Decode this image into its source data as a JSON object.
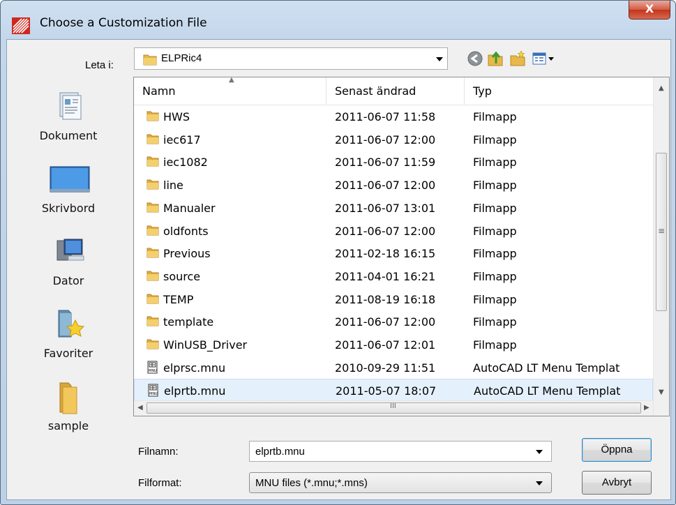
{
  "window": {
    "title": "Choose a Customization File",
    "close_glyph": "X",
    "icon": "autocad-logo-icon"
  },
  "lookin": {
    "label": "Leta i:",
    "value": "ELPRic4",
    "toolbar_icons": [
      "back-icon",
      "up-folder-icon",
      "new-folder-icon",
      "view-menu-icon"
    ]
  },
  "places": [
    {
      "label": "Dokument",
      "icon": "documents-icon"
    },
    {
      "label": "Skrivbord",
      "icon": "desktop-icon"
    },
    {
      "label": "Dator",
      "icon": "computer-icon"
    },
    {
      "label": "Favoriter",
      "icon": "favorites-icon"
    },
    {
      "label": "sample",
      "icon": "folder-icon"
    }
  ],
  "filelist": {
    "columns": [
      "Namn",
      "Senast ändrad",
      "Typ"
    ],
    "rows": [
      {
        "name": "HWS",
        "date": "2011-06-07 11:58",
        "type": "Filmapp",
        "icon": "folder-icon"
      },
      {
        "name": "iec617",
        "date": "2011-06-07 12:00",
        "type": "Filmapp",
        "icon": "folder-icon"
      },
      {
        "name": "iec1082",
        "date": "2011-06-07 11:59",
        "type": "Filmapp",
        "icon": "folder-icon"
      },
      {
        "name": "line",
        "date": "2011-06-07 12:00",
        "type": "Filmapp",
        "icon": "folder-icon"
      },
      {
        "name": "Manualer",
        "date": "2011-06-07 13:01",
        "type": "Filmapp",
        "icon": "folder-icon"
      },
      {
        "name": "oldfonts",
        "date": "2011-06-07 12:00",
        "type": "Filmapp",
        "icon": "folder-icon"
      },
      {
        "name": "Previous",
        "date": "2011-02-18 16:15",
        "type": "Filmapp",
        "icon": "folder-icon"
      },
      {
        "name": "source",
        "date": "2011-04-01 16:21",
        "type": "Filmapp",
        "icon": "folder-icon"
      },
      {
        "name": "TEMP",
        "date": "2011-08-19 16:18",
        "type": "Filmapp",
        "icon": "folder-icon"
      },
      {
        "name": "template",
        "date": "2011-06-07 12:00",
        "type": "Filmapp",
        "icon": "folder-icon"
      },
      {
        "name": "WinUSB_Driver",
        "date": "2011-06-07 12:01",
        "type": "Filmapp",
        "icon": "folder-icon"
      },
      {
        "name": "elprsc.mnu",
        "date": "2010-09-29 11:51",
        "type": "AutoCAD LT Menu Templat",
        "icon": "mnu-file-icon"
      },
      {
        "name": "elprtb.mnu",
        "date": "2011-05-07 18:07",
        "type": "AutoCAD LT Menu Templat",
        "icon": "mnu-file-icon",
        "selected": true
      }
    ]
  },
  "scroll": {
    "hgrip": "III",
    "vgrip": "≡"
  },
  "filename": {
    "label": "Filnamn:",
    "value": "elprtb.mnu"
  },
  "fileformat": {
    "label": "Filformat:",
    "value": "MNU files (*.mnu;*.mns)"
  },
  "buttons": {
    "open": "Öppna",
    "cancel": "Avbryt"
  },
  "colors": {
    "selection": "#e4f0fb",
    "folder": "#e8b84a",
    "title_gradient": "#cfe0f1"
  }
}
